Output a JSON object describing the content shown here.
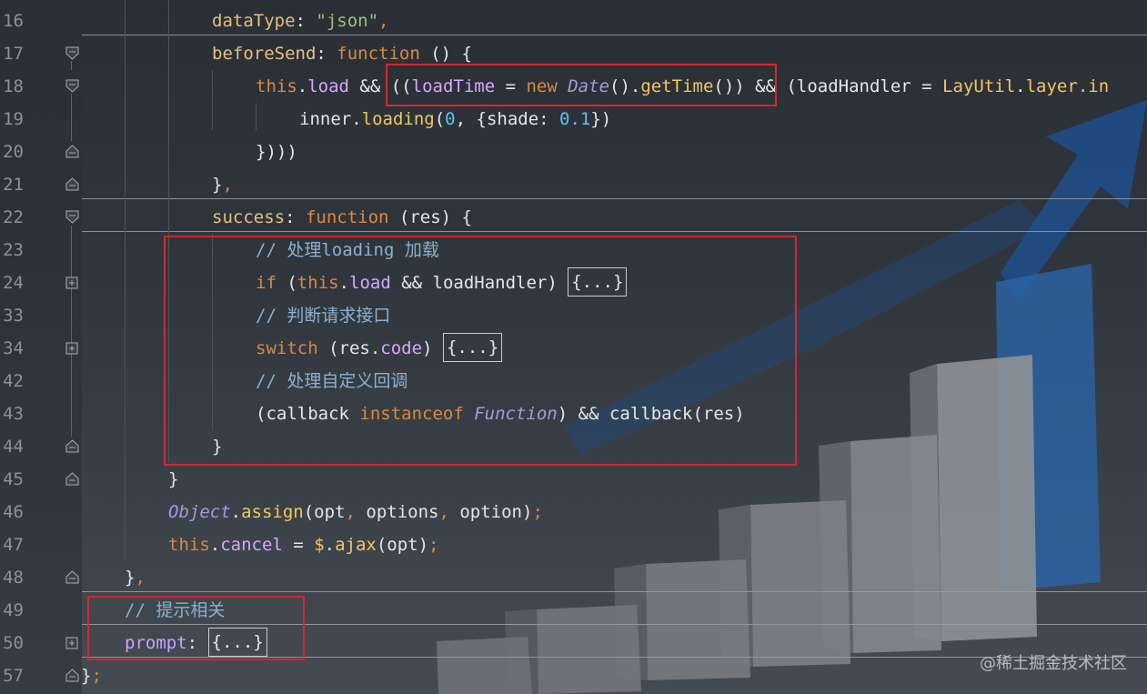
{
  "editor": {
    "line_numbers": [
      "16",
      "17",
      "18",
      "19",
      "20",
      "21",
      "22",
      "23",
      "24",
      "33",
      "34",
      "42",
      "43",
      "44",
      "45",
      "46",
      "47",
      "48",
      "49",
      "50",
      "57"
    ],
    "lines": {
      "l16": {
        "a": "dataType",
        "b": ": ",
        "c": "\"json\"",
        "d": ","
      },
      "l17": {
        "a": "beforeSend",
        "b": ": ",
        "c": "function",
        "d": " () {"
      },
      "l18": {
        "a": "this",
        "b": ".",
        "c": "load",
        "d": " && ((",
        "e": "loadTime",
        "f": " = ",
        "g": "new ",
        "h": "Date",
        "i": "().",
        "j": "getTime",
        "k": "()) && (loadHandler = ",
        "l": "LayUtil",
        "m": ".",
        "n": "layer",
        "o": ".in"
      },
      "l19": {
        "a": "inner.",
        "b": "loading",
        "c": "(",
        "d": "0",
        "e": ", {shade: ",
        "f": "0.1",
        "g": "})"
      },
      "l20": {
        "a": "})))"
      },
      "l21": {
        "a": "}",
        "b": ","
      },
      "l22": {
        "a": "success",
        "b": ": ",
        "c": "function",
        "d": " (res) {"
      },
      "l23": {
        "a": "// 处理loading 加载"
      },
      "l24": {
        "a": "if",
        "b": " (",
        "c": "this",
        "d": ".",
        "e": "load",
        "f": " && loadHandler) ",
        "g": "{...}"
      },
      "l33": {
        "a": "// 判断请求接口"
      },
      "l34": {
        "a": "switch",
        "b": " (res.",
        "c": "code",
        "d": ") ",
        "e": "{...}"
      },
      "l42": {
        "a": "// 处理自定义回调"
      },
      "l43": {
        "a": "(callback ",
        "b": "instanceof",
        "c": " ",
        "d": "Function",
        "e": ") && callback(res)"
      },
      "l44": {
        "a": "}"
      },
      "l45": {
        "a": "}"
      },
      "l46": {
        "a": "Object",
        "b": ".",
        "c": "assign",
        "d": "(opt",
        "e": ",",
        "f": " options",
        "g": ",",
        "h": " option)",
        "i": ";"
      },
      "l47": {
        "a": "this",
        "b": ".",
        "c": "cancel",
        "d": " = ",
        "e": "$",
        "f": ".",
        "g": "ajax",
        "h": "(opt)",
        "i": ";"
      },
      "l48": {
        "a": "}",
        "b": ","
      },
      "l49": {
        "a": "// 提示相关"
      },
      "l50": {
        "a": "prompt",
        "b": ": ",
        "c": "{...}"
      },
      "l57": {
        "a": "}",
        "b": ";"
      }
    }
  },
  "watermark": "@稀土掘金技术社区",
  "colors": {
    "highlight_box": "#d3282e",
    "background": "#2c3138"
  }
}
